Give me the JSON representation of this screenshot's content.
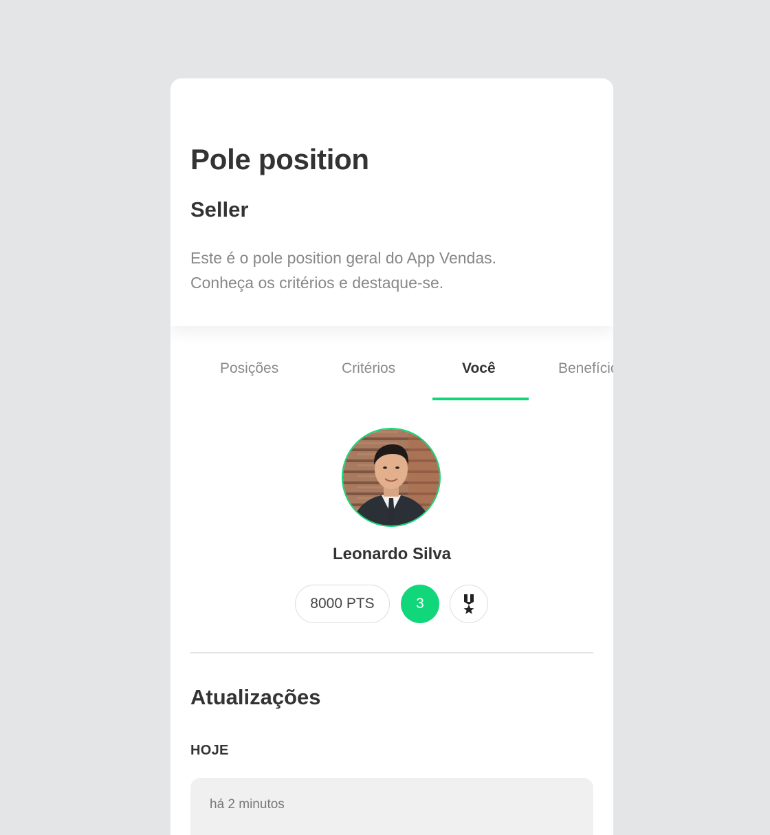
{
  "header": {
    "title": "Pole position",
    "subtitle": "Seller",
    "description_lines": [
      "Este é o pole position geral do App Vendas.",
      "Conheça os critérios e destaque-se."
    ]
  },
  "tabs": [
    {
      "label": "Posições",
      "active": false
    },
    {
      "label": "Critérios",
      "active": false
    },
    {
      "label": "Você",
      "active": true
    },
    {
      "label": "Benefícios",
      "active": false
    }
  ],
  "profile": {
    "name": "Leonardo Silva",
    "points": "8000 PTS",
    "rank": "3",
    "medal_icon": "medal-icon"
  },
  "updates": {
    "title": "Atualizações",
    "groups": [
      {
        "day": "HOJE",
        "items": [
          {
            "time": "há 2 minutos"
          }
        ]
      }
    ]
  },
  "colors": {
    "accent": "#12d67a",
    "background": "#e4e5e7",
    "card": "#ffffff",
    "text_primary": "#333333",
    "text_secondary": "#878787"
  }
}
